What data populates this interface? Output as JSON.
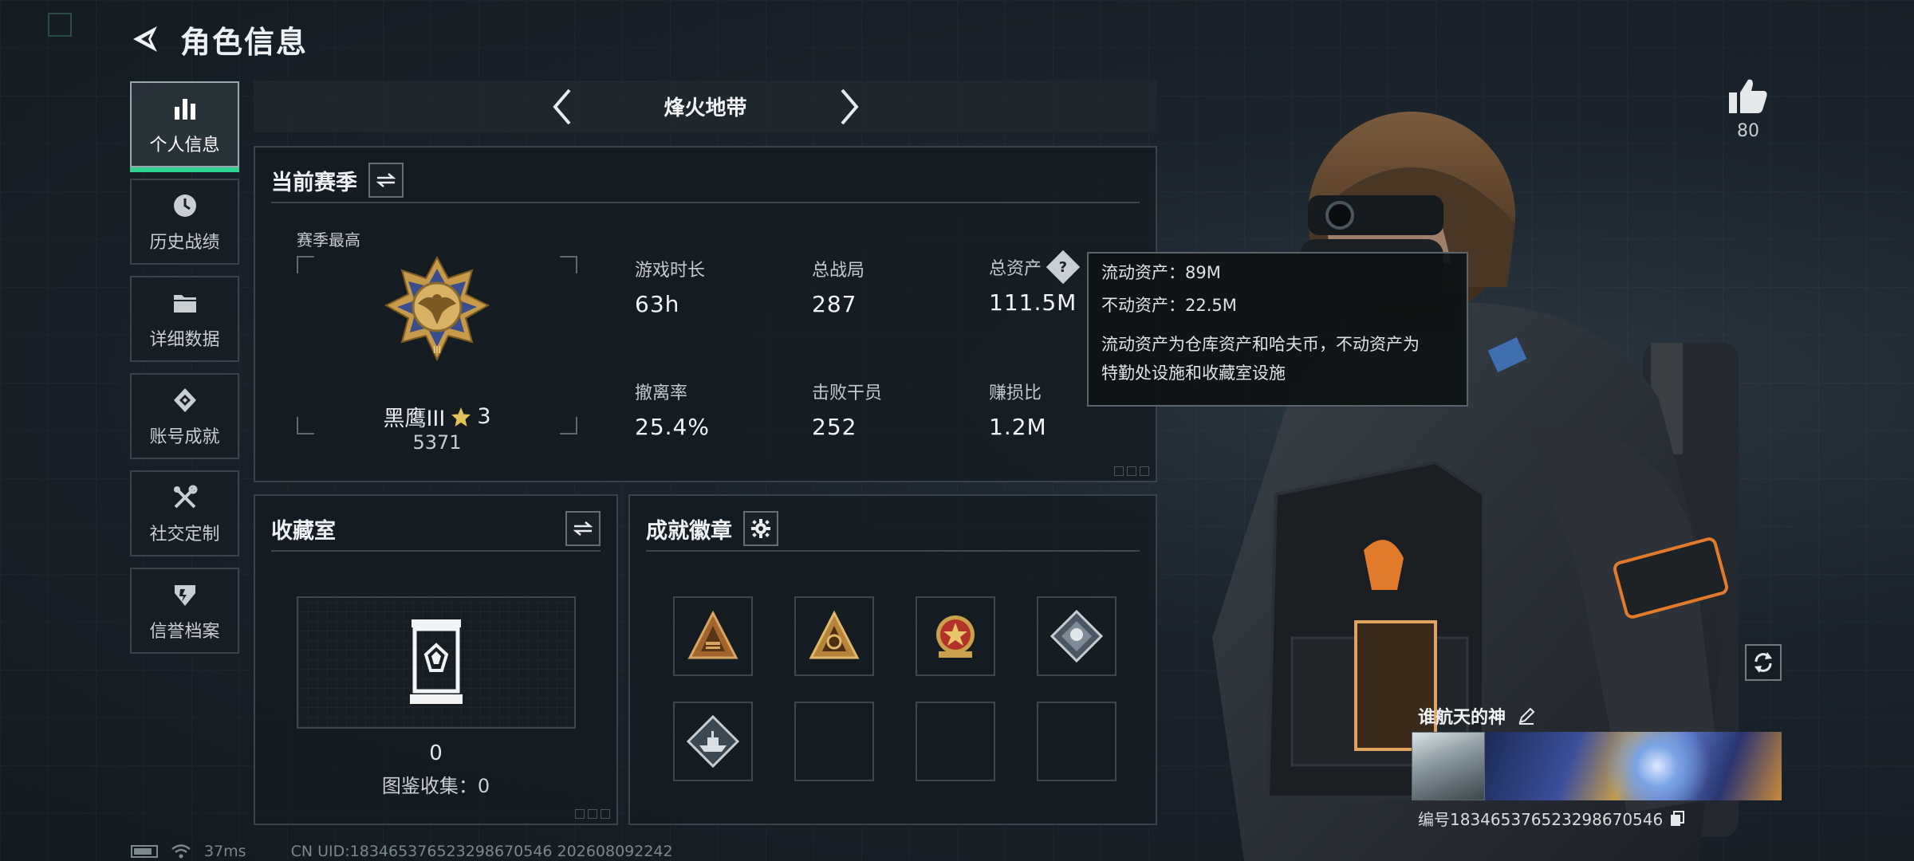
{
  "header": {
    "title": "角色信息"
  },
  "sidebar": {
    "items": [
      {
        "label": "个人信息",
        "icon": "bar-chart-icon",
        "active": true
      },
      {
        "label": "历史战绩",
        "icon": "clock-icon",
        "active": false
      },
      {
        "label": "详细数据",
        "icon": "folder-icon",
        "active": false
      },
      {
        "label": "账号成就",
        "icon": "achievement-icon",
        "active": false
      },
      {
        "label": "社交定制",
        "icon": "tools-icon",
        "active": false
      },
      {
        "label": "信誉档案",
        "icon": "shield-icon",
        "active": false
      }
    ]
  },
  "mode": {
    "title": "烽火地带"
  },
  "season": {
    "title": "当前赛季",
    "peak_label": "赛季最高",
    "rank_name": "黑鹰III",
    "rank_stars": "3",
    "rank_score": "5371",
    "stats": [
      {
        "label": "游戏时长",
        "value": "63h"
      },
      {
        "label": "总战局",
        "value": "287"
      },
      {
        "label": "总资产",
        "value": "111.5M"
      },
      {
        "label": "撤离率",
        "value": "25.4%"
      },
      {
        "label": "击败干员",
        "value": "252"
      },
      {
        "label": "赚损比",
        "value": "1.2M"
      }
    ]
  },
  "tooltip": {
    "liquid": "流动资产：89M",
    "fixed": "不动资产：22.5M",
    "desc_line1": "流动资产为仓库资产和哈夫币，不动资产为",
    "desc_line2": "特勤处设施和收藏室设施"
  },
  "collection": {
    "title": "收藏室",
    "count": "0",
    "sub": "图鉴收集：0"
  },
  "achievements": {
    "title": "成就徽章",
    "badges": [
      "triangle-bronze-badge",
      "triangle-gold-badge",
      "medal-red-badge",
      "diamond-silver-badge",
      "diamond-ship-badge",
      "",
      "",
      ""
    ]
  },
  "likes": {
    "count": "80"
  },
  "player": {
    "name": "谁航天的神",
    "uid": "编号1834653765232986705​46"
  },
  "status_bar": {
    "ping": "37ms",
    "server": "CN UID:1834653765232986705​46 202608092242"
  },
  "colors": {
    "accent_green": "#2fd38f",
    "panel_border": "#3a434b",
    "background": "#1a232c"
  }
}
